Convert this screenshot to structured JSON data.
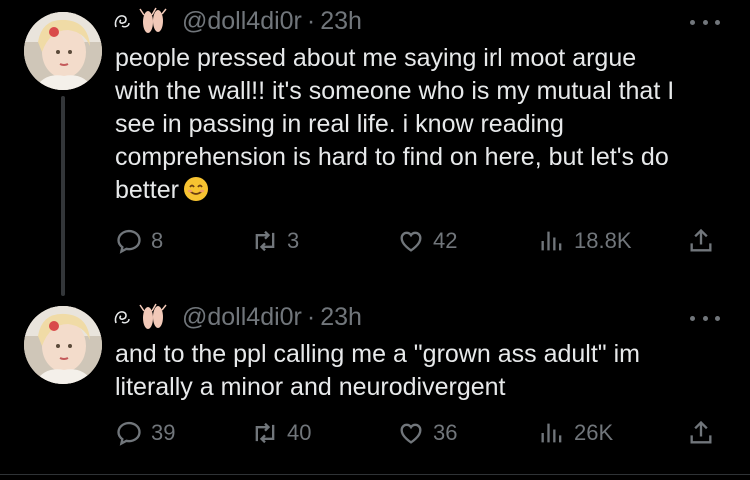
{
  "tweets": [
    {
      "handle": "@doll4di0r",
      "separator": "·",
      "time": "23h",
      "text": "people pressed about me saying irl moot argue\nwith the wall!! it's someone who is my mutual that I\nsee in passing in real life. i know reading\ncomprehension is hard to find on here, but let's do\nbetter",
      "emoji": "smiling-face-emoji",
      "replies": "8",
      "reposts": "3",
      "likes": "42",
      "views": "18.8K"
    },
    {
      "handle": "@doll4di0r",
      "separator": "·",
      "time": "23h",
      "text": "and to the ppl calling me a \"grown ass adult\" im\nliterally a minor and neurodivergent",
      "replies": "39",
      "reposts": "40",
      "likes": "36",
      "views": "26K"
    }
  ],
  "colors": {
    "background": "#000000",
    "text": "#e7e9ea",
    "muted": "#71767b",
    "thread_line": "#333639"
  },
  "icons": [
    "reply-icon",
    "repost-icon",
    "like-icon",
    "views-icon",
    "share-icon",
    "more-icon"
  ]
}
